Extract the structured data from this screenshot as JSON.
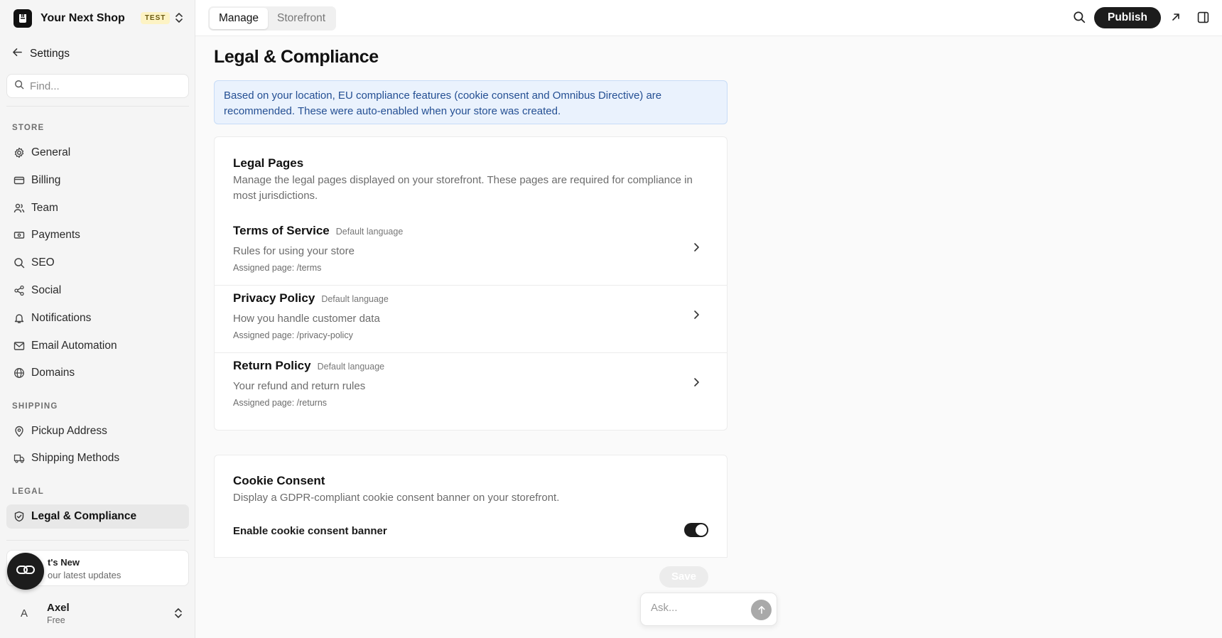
{
  "shop": {
    "name": "Your Next Shop",
    "badge": "TEST"
  },
  "sidebar": {
    "back_label": "Settings",
    "find_placeholder": "Find...",
    "sections": {
      "store": "STORE",
      "shipping": "SHIPPING",
      "legal": "LEGAL"
    },
    "items": [
      {
        "label": "General",
        "icon": "gear-icon"
      },
      {
        "label": "Billing",
        "icon": "credit-card-icon"
      },
      {
        "label": "Team",
        "icon": "users-icon"
      },
      {
        "label": "Payments",
        "icon": "banknote-icon"
      },
      {
        "label": "SEO",
        "icon": "search-icon"
      },
      {
        "label": "Social",
        "icon": "share-icon"
      },
      {
        "label": "Notifications",
        "icon": "bell-icon"
      },
      {
        "label": "Email Automation",
        "icon": "mail-icon"
      },
      {
        "label": "Domains",
        "icon": "globe-icon"
      },
      {
        "label": "Pickup Address",
        "icon": "map-pin-icon"
      },
      {
        "label": "Shipping Methods",
        "icon": "truck-icon"
      },
      {
        "label": "Legal & Compliance",
        "icon": "shield-check-icon",
        "active": true
      }
    ],
    "whats_new": {
      "title": "What's New",
      "subtitle": "See our latest updates",
      "visible_title": "t's New",
      "visible_subtitle": "our latest updates"
    },
    "user": {
      "avatar": "A",
      "name": "Axel",
      "plan": "Free"
    }
  },
  "topbar": {
    "tabs": [
      {
        "label": "Manage",
        "active": true
      },
      {
        "label": "Storefront",
        "active": false
      }
    ],
    "publish_label": "Publish"
  },
  "main": {
    "title": "Legal & Compliance",
    "banner": "Based on your location, EU compliance features (cookie consent and Omnibus Directive) are recommended. These were auto-enabled when your store was created.",
    "legal_pages": {
      "title": "Legal Pages",
      "description": "Manage the legal pages displayed on your storefront. These pages are required for compliance in most jurisdictions.",
      "rows": [
        {
          "name": "Terms of Service",
          "lang": "Default language",
          "desc": "Rules for using your store",
          "assigned": "Assigned page: /terms"
        },
        {
          "name": "Privacy Policy",
          "lang": "Default language",
          "desc": "How you handle customer data",
          "assigned": "Assigned page: /privacy-policy"
        },
        {
          "name": "Return Policy",
          "lang": "Default language",
          "desc": "Your refund and return rules",
          "assigned": "Assigned page: /returns"
        }
      ]
    },
    "cookie_consent": {
      "title": "Cookie Consent",
      "description": "Display a GDPR-compliant cookie consent banner on your storefront.",
      "toggle_label": "Enable cookie consent banner",
      "enabled": true
    },
    "save_label": "Save",
    "ask_placeholder": "Ask..."
  },
  "colors": {
    "accent": "#1c1c1c",
    "banner_bg": "#eaf2fd",
    "banner_text": "#244f93",
    "test_badge": "#fdf3c4"
  }
}
